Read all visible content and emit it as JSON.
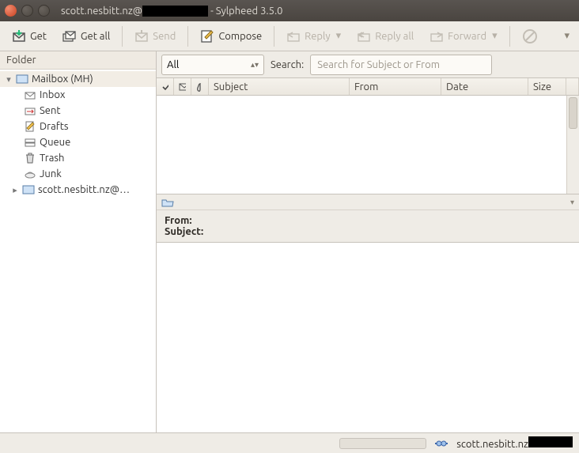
{
  "window": {
    "title_prefix": "scott.nesbitt.nz@",
    "title_suffix": "- Sylpheed 3.5.0"
  },
  "toolbar": {
    "get": "Get",
    "get_all": "Get all",
    "send": "Send",
    "compose": "Compose",
    "reply": "Reply",
    "reply_all": "Reply all",
    "forward": "Forward"
  },
  "sidebar": {
    "header": "Folder",
    "mailbox": "Mailbox (MH)",
    "folders": {
      "inbox": "Inbox",
      "sent": "Sent",
      "drafts": "Drafts",
      "queue": "Queue",
      "trash": "Trash",
      "junk": "Junk"
    },
    "account": "scott.nesbitt.nz@…"
  },
  "filter": {
    "combo": "All",
    "search_label": "Search:",
    "search_placeholder": "Search for Subject or From"
  },
  "columns": {
    "subject": "Subject",
    "from": "From",
    "date": "Date",
    "size": "Size"
  },
  "message": {
    "from_label": "From:",
    "subject_label": "Subject:"
  },
  "status": {
    "account": "scott.nesbitt.nz"
  }
}
